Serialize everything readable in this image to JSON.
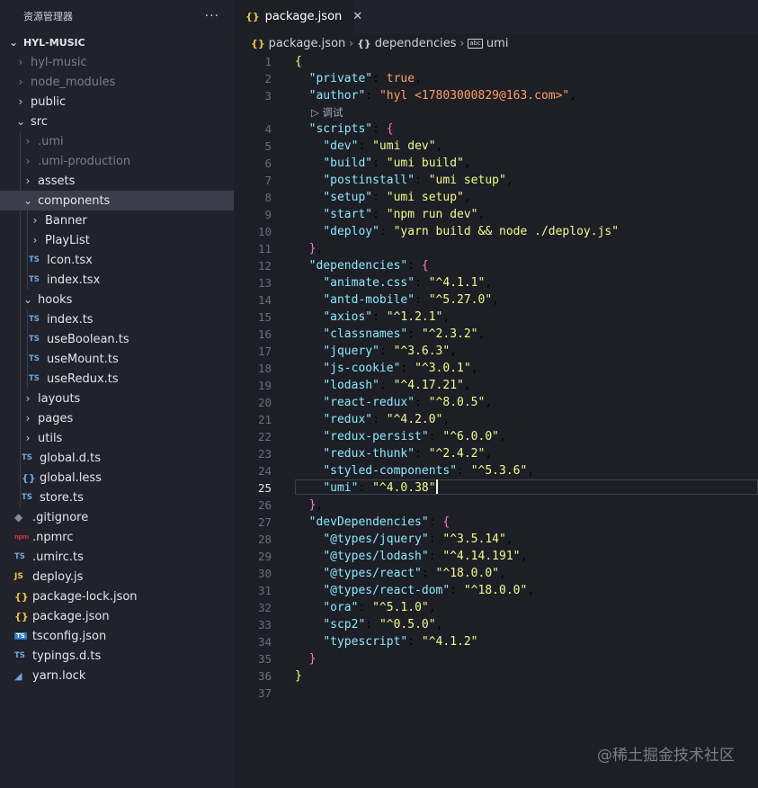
{
  "sidebar": {
    "title": "资源管理器",
    "more": "···",
    "items": [
      {
        "label": "HYL-MUSIC",
        "indent": 0,
        "kind": "root",
        "chev": "⌄"
      },
      {
        "label": "hyl-music",
        "indent": 1,
        "kind": "folder",
        "chev": "›",
        "dim": true
      },
      {
        "label": "node_modules",
        "indent": 1,
        "kind": "folder",
        "chev": "›",
        "dim": true
      },
      {
        "label": "public",
        "indent": 1,
        "kind": "folder",
        "chev": "›"
      },
      {
        "label": "src",
        "indent": 1,
        "kind": "folder",
        "chev": "⌄"
      },
      {
        "label": ".umi",
        "indent": 2,
        "kind": "folder",
        "chev": "›",
        "dim": true
      },
      {
        "label": ".umi-production",
        "indent": 2,
        "kind": "folder",
        "chev": "›",
        "dim": true
      },
      {
        "label": "assets",
        "indent": 2,
        "kind": "folder",
        "chev": "›"
      },
      {
        "label": "components",
        "indent": 2,
        "kind": "folder",
        "chev": "⌄",
        "selected": true
      },
      {
        "label": "Banner",
        "indent": 3,
        "kind": "folder",
        "chev": "›"
      },
      {
        "label": "PlayList",
        "indent": 3,
        "kind": "folder",
        "chev": "›"
      },
      {
        "label": "Icon.tsx",
        "indent": 3,
        "kind": "file",
        "icon": "ts"
      },
      {
        "label": "index.tsx",
        "indent": 3,
        "kind": "file",
        "icon": "ts"
      },
      {
        "label": "hooks",
        "indent": 2,
        "kind": "folder",
        "chev": "⌄"
      },
      {
        "label": "index.ts",
        "indent": 3,
        "kind": "file",
        "icon": "ts"
      },
      {
        "label": "useBoolean.ts",
        "indent": 3,
        "kind": "file",
        "icon": "ts"
      },
      {
        "label": "useMount.ts",
        "indent": 3,
        "kind": "file",
        "icon": "ts"
      },
      {
        "label": "useRedux.ts",
        "indent": 3,
        "kind": "file",
        "icon": "ts"
      },
      {
        "label": "layouts",
        "indent": 2,
        "kind": "folder",
        "chev": "›"
      },
      {
        "label": "pages",
        "indent": 2,
        "kind": "folder",
        "chev": "›"
      },
      {
        "label": "utils",
        "indent": 2,
        "kind": "folder",
        "chev": "›"
      },
      {
        "label": "global.d.ts",
        "indent": 2,
        "kind": "file",
        "icon": "ts"
      },
      {
        "label": "global.less",
        "indent": 2,
        "kind": "file",
        "icon": "less"
      },
      {
        "label": "store.ts",
        "indent": 2,
        "kind": "file",
        "icon": "ts"
      },
      {
        "label": ".gitignore",
        "indent": 1,
        "kind": "file",
        "icon": "git"
      },
      {
        "label": ".npmrc",
        "indent": 1,
        "kind": "file",
        "icon": "npm"
      },
      {
        "label": ".umirc.ts",
        "indent": 1,
        "kind": "file",
        "icon": "ts"
      },
      {
        "label": "deploy.js",
        "indent": 1,
        "kind": "file",
        "icon": "js"
      },
      {
        "label": "package-lock.json",
        "indent": 1,
        "kind": "file",
        "icon": "json"
      },
      {
        "label": "package.json",
        "indent": 1,
        "kind": "file",
        "icon": "json"
      },
      {
        "label": "tsconfig.json",
        "indent": 1,
        "kind": "file",
        "icon": "tsconf"
      },
      {
        "label": "typings.d.ts",
        "indent": 1,
        "kind": "file",
        "icon": "ts"
      },
      {
        "label": "yarn.lock",
        "indent": 1,
        "kind": "file",
        "icon": "yarn"
      }
    ]
  },
  "icons": {
    "ts": "TS",
    "json": "{}",
    "less": "{}",
    "js": "JS",
    "git": "◆",
    "npm": "npm",
    "tsconf": "TS",
    "yarn": "◢"
  },
  "tab": {
    "label": "package.json",
    "icon": "{}",
    "close": "✕"
  },
  "breadcrumb": {
    "file": "package.json",
    "section": "dependencies",
    "leaf": "umi",
    "file_icon": "{}",
    "section_icon": "{}",
    "leaf_icon": "abc",
    "sep": "›"
  },
  "codelens": "▷ 调试",
  "active_line": 25,
  "code": [
    [
      {
        "t": "{",
        "c": "b1"
      }
    ],
    [
      {
        "t": "  "
      },
      {
        "t": "\"private\"",
        "c": "key"
      },
      {
        "t": ": "
      },
      {
        "t": "true",
        "c": "bool"
      },
      {
        "t": ","
      }
    ],
    [
      {
        "t": "  "
      },
      {
        "t": "\"author\"",
        "c": "key"
      },
      {
        "t": ": "
      },
      {
        "t": "\"hyl <17803000829@163.com>\"",
        "c": "bool"
      },
      {
        "t": ","
      }
    ],
    [
      {
        "t": "  "
      },
      {
        "t": "\"scripts\"",
        "c": "key"
      },
      {
        "t": ": "
      },
      {
        "t": "{",
        "c": "b2"
      }
    ],
    [
      {
        "t": "    "
      },
      {
        "t": "\"dev\"",
        "c": "key"
      },
      {
        "t": ": "
      },
      {
        "t": "\"umi dev\"",
        "c": "str"
      },
      {
        "t": ","
      }
    ],
    [
      {
        "t": "    "
      },
      {
        "t": "\"build\"",
        "c": "key"
      },
      {
        "t": ": "
      },
      {
        "t": "\"umi build\"",
        "c": "str"
      },
      {
        "t": ","
      }
    ],
    [
      {
        "t": "    "
      },
      {
        "t": "\"postinstall\"",
        "c": "key"
      },
      {
        "t": ": "
      },
      {
        "t": "\"umi setup\"",
        "c": "str"
      },
      {
        "t": ","
      }
    ],
    [
      {
        "t": "    "
      },
      {
        "t": "\"setup\"",
        "c": "key"
      },
      {
        "t": ": "
      },
      {
        "t": "\"umi setup\"",
        "c": "str"
      },
      {
        "t": ","
      }
    ],
    [
      {
        "t": "    "
      },
      {
        "t": "\"start\"",
        "c": "key"
      },
      {
        "t": ": "
      },
      {
        "t": "\"npm run dev\"",
        "c": "str"
      },
      {
        "t": ","
      }
    ],
    [
      {
        "t": "    "
      },
      {
        "t": "\"deploy\"",
        "c": "key"
      },
      {
        "t": ": "
      },
      {
        "t": "\"yarn build && node ./deploy.js\"",
        "c": "str"
      }
    ],
    [
      {
        "t": "  "
      },
      {
        "t": "}",
        "c": "b2"
      },
      {
        "t": ","
      }
    ],
    [
      {
        "t": "  "
      },
      {
        "t": "\"dependencies\"",
        "c": "key"
      },
      {
        "t": ": "
      },
      {
        "t": "{",
        "c": "b2"
      }
    ],
    [
      {
        "t": "    "
      },
      {
        "t": "\"animate.css\"",
        "c": "key"
      },
      {
        "t": ": "
      },
      {
        "t": "\"^4.1.1\"",
        "c": "str"
      },
      {
        "t": ","
      }
    ],
    [
      {
        "t": "    "
      },
      {
        "t": "\"antd-mobile\"",
        "c": "key"
      },
      {
        "t": ": "
      },
      {
        "t": "\"^5.27.0\"",
        "c": "str"
      },
      {
        "t": ","
      }
    ],
    [
      {
        "t": "    "
      },
      {
        "t": "\"axios\"",
        "c": "key"
      },
      {
        "t": ": "
      },
      {
        "t": "\"^1.2.1\"",
        "c": "str"
      },
      {
        "t": ","
      }
    ],
    [
      {
        "t": "    "
      },
      {
        "t": "\"classnames\"",
        "c": "key"
      },
      {
        "t": ": "
      },
      {
        "t": "\"^2.3.2\"",
        "c": "str"
      },
      {
        "t": ","
      }
    ],
    [
      {
        "t": "    "
      },
      {
        "t": "\"jquery\"",
        "c": "key"
      },
      {
        "t": ": "
      },
      {
        "t": "\"^3.6.3\"",
        "c": "str"
      },
      {
        "t": ","
      }
    ],
    [
      {
        "t": "    "
      },
      {
        "t": "\"js-cookie\"",
        "c": "key"
      },
      {
        "t": ": "
      },
      {
        "t": "\"^3.0.1\"",
        "c": "str"
      },
      {
        "t": ","
      }
    ],
    [
      {
        "t": "    "
      },
      {
        "t": "\"lodash\"",
        "c": "key"
      },
      {
        "t": ": "
      },
      {
        "t": "\"^4.17.21\"",
        "c": "str"
      },
      {
        "t": ","
      }
    ],
    [
      {
        "t": "    "
      },
      {
        "t": "\"react-redux\"",
        "c": "key"
      },
      {
        "t": ": "
      },
      {
        "t": "\"^8.0.5\"",
        "c": "str"
      },
      {
        "t": ","
      }
    ],
    [
      {
        "t": "    "
      },
      {
        "t": "\"redux\"",
        "c": "key"
      },
      {
        "t": ": "
      },
      {
        "t": "\"^4.2.0\"",
        "c": "str"
      },
      {
        "t": ","
      }
    ],
    [
      {
        "t": "    "
      },
      {
        "t": "\"redux-persist\"",
        "c": "key"
      },
      {
        "t": ": "
      },
      {
        "t": "\"^6.0.0\"",
        "c": "str"
      },
      {
        "t": ","
      }
    ],
    [
      {
        "t": "    "
      },
      {
        "t": "\"redux-thunk\"",
        "c": "key"
      },
      {
        "t": ": "
      },
      {
        "t": "\"^2.4.2\"",
        "c": "str"
      },
      {
        "t": ","
      }
    ],
    [
      {
        "t": "    "
      },
      {
        "t": "\"styled-components\"",
        "c": "key"
      },
      {
        "t": ": "
      },
      {
        "t": "\"^5.3.6\"",
        "c": "str"
      },
      {
        "t": ","
      }
    ],
    [
      {
        "t": "    "
      },
      {
        "t": "\"umi\"",
        "c": "key"
      },
      {
        "t": ": "
      },
      {
        "t": "\"^4.0.38\"",
        "c": "str"
      }
    ],
    [
      {
        "t": "  "
      },
      {
        "t": "}",
        "c": "b2"
      },
      {
        "t": ","
      }
    ],
    [
      {
        "t": "  "
      },
      {
        "t": "\"devDependencies\"",
        "c": "key"
      },
      {
        "t": ": "
      },
      {
        "t": "{",
        "c": "b2"
      }
    ],
    [
      {
        "t": "    "
      },
      {
        "t": "\"@types/jquery\"",
        "c": "key"
      },
      {
        "t": ": "
      },
      {
        "t": "\"^3.5.14\"",
        "c": "str"
      },
      {
        "t": ","
      }
    ],
    [
      {
        "t": "    "
      },
      {
        "t": "\"@types/lodash\"",
        "c": "key"
      },
      {
        "t": ": "
      },
      {
        "t": "\"^4.14.191\"",
        "c": "str"
      },
      {
        "t": ","
      }
    ],
    [
      {
        "t": "    "
      },
      {
        "t": "\"@types/react\"",
        "c": "key"
      },
      {
        "t": ": "
      },
      {
        "t": "\"^18.0.0\"",
        "c": "str"
      },
      {
        "t": ","
      }
    ],
    [
      {
        "t": "    "
      },
      {
        "t": "\"@types/react-dom\"",
        "c": "key"
      },
      {
        "t": ": "
      },
      {
        "t": "\"^18.0.0\"",
        "c": "str"
      },
      {
        "t": ","
      }
    ],
    [
      {
        "t": "    "
      },
      {
        "t": "\"ora\"",
        "c": "key"
      },
      {
        "t": ": "
      },
      {
        "t": "\"^5.1.0\"",
        "c": "str"
      },
      {
        "t": ","
      }
    ],
    [
      {
        "t": "    "
      },
      {
        "t": "\"scp2\"",
        "c": "key"
      },
      {
        "t": ": "
      },
      {
        "t": "\"^0.5.0\"",
        "c": "str"
      },
      {
        "t": ","
      }
    ],
    [
      {
        "t": "    "
      },
      {
        "t": "\"typescript\"",
        "c": "key"
      },
      {
        "t": ": "
      },
      {
        "t": "\"^4.1.2\"",
        "c": "str"
      }
    ],
    [
      {
        "t": "  "
      },
      {
        "t": "}",
        "c": "b2"
      }
    ],
    [
      {
        "t": "}",
        "c": "b1"
      }
    ],
    []
  ],
  "watermark": "@稀土掘金技术社区"
}
